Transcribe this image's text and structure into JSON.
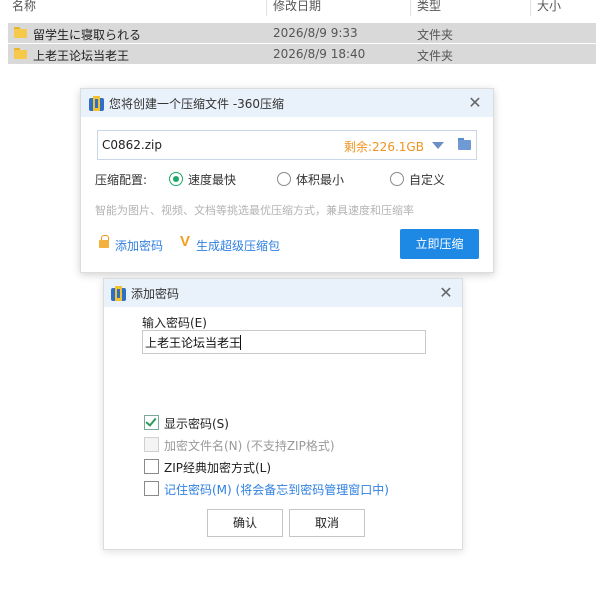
{
  "list": {
    "headers": {
      "name": "名称",
      "modified": "修改日期",
      "type": "类型",
      "size": "大小"
    },
    "rows": [
      {
        "name": "留学生に寝取られる",
        "modified": "2026/8/9 9:33",
        "type": "文件夹"
      },
      {
        "name": "上老王论坛当老王",
        "modified": "2026/8/9 18:40",
        "type": "文件夹"
      }
    ]
  },
  "compress_dialog": {
    "title": "您将创建一个压缩文件 -360压缩",
    "filename": "C0862.zip",
    "remaining": "剩余:226.1GB",
    "config_label": "压缩配置:",
    "options": [
      "速度最快",
      "体积最小",
      "自定义"
    ],
    "selected_option": "速度最快",
    "hint": "智能为图片、视频、文档等挑选最优压缩方式，兼具速度和压缩率",
    "add_password": "添加密码",
    "super_pack": "生成超级压缩包",
    "compress_button": "立即压缩",
    "accent_color": "#1e88e5",
    "remaining_color": "#f0931e"
  },
  "password_dialog": {
    "title": "添加密码",
    "field_label": "输入密码(E)",
    "password_value": "上老王论坛当老王",
    "checkboxes": [
      {
        "label": "显示密码(S)",
        "checked": true,
        "enabled": true
      },
      {
        "label": "加密文件名(N) (不支持ZIP格式)",
        "checked": false,
        "enabled": false
      },
      {
        "label": "ZIP经典加密方式(L)",
        "checked": false,
        "enabled": true
      },
      {
        "label": "记住密码(M) (将会备忘到密码管理窗口中)",
        "checked": false,
        "enabled": true
      }
    ],
    "ok": "确认",
    "cancel": "取消"
  }
}
